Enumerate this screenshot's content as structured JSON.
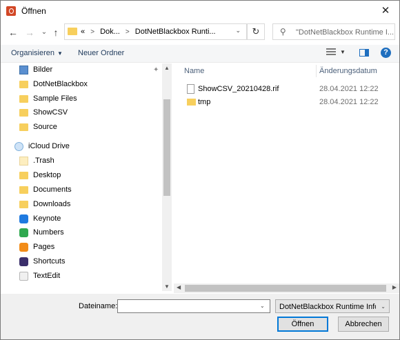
{
  "window": {
    "title": "Öffnen",
    "close_glyph": "✕"
  },
  "nav_buttons": {
    "back": "←",
    "forward": "→",
    "recent": "⌄",
    "up": "↑"
  },
  "address": {
    "crumbs": [
      "«",
      "Dok...",
      "DotNetBlackbox Runti..."
    ],
    "dropdown": "⌄",
    "refresh_glyph": "↻"
  },
  "search": {
    "placeholder": "\"DotNetBlackbox Runtime I..."
  },
  "toolbar": {
    "organize": "Organisieren",
    "new_folder": "Neuer Ordner",
    "help": "?"
  },
  "sidebar": {
    "items": [
      {
        "label": "Bilder",
        "icon": "pictures-icon",
        "pinned": true
      },
      {
        "label": "DotNetBlackbox",
        "icon": "folder-icon"
      },
      {
        "label": "Sample Files",
        "icon": "folder-icon"
      },
      {
        "label": "ShowCSV",
        "icon": "folder-icon"
      },
      {
        "label": "Source",
        "icon": "folder-icon"
      },
      {
        "label": "iCloud Drive",
        "icon": "icloud-icon"
      },
      {
        "label": ".Trash",
        "icon": "folder-pale-icon"
      },
      {
        "label": "Desktop",
        "icon": "folder-icon"
      },
      {
        "label": "Documents",
        "icon": "folder-icon"
      },
      {
        "label": "Downloads",
        "icon": "folder-icon"
      },
      {
        "label": "Keynote",
        "icon": "keynote-icon"
      },
      {
        "label": "Numbers",
        "icon": "numbers-icon"
      },
      {
        "label": "Pages",
        "icon": "pages-icon"
      },
      {
        "label": "Shortcuts",
        "icon": "shortcuts-icon"
      },
      {
        "label": "TextEdit",
        "icon": "textedit-icon"
      }
    ]
  },
  "file_list": {
    "columns": {
      "name": "Name",
      "date": "Änderungsdatum"
    },
    "rows": [
      {
        "name": "ShowCSV_20210428.rif",
        "date": "28.04.2021 12:22",
        "icon": "document-icon"
      },
      {
        "name": "tmp",
        "date": "28.04.2021 12:22",
        "icon": "folder-icon"
      }
    ]
  },
  "footer": {
    "filename_label": "Dateiname:",
    "filename_value": "",
    "filetype": "DotNetBlackbox Runtime Infor",
    "open_button": "Öffnen",
    "cancel_button": "Abbrechen"
  }
}
